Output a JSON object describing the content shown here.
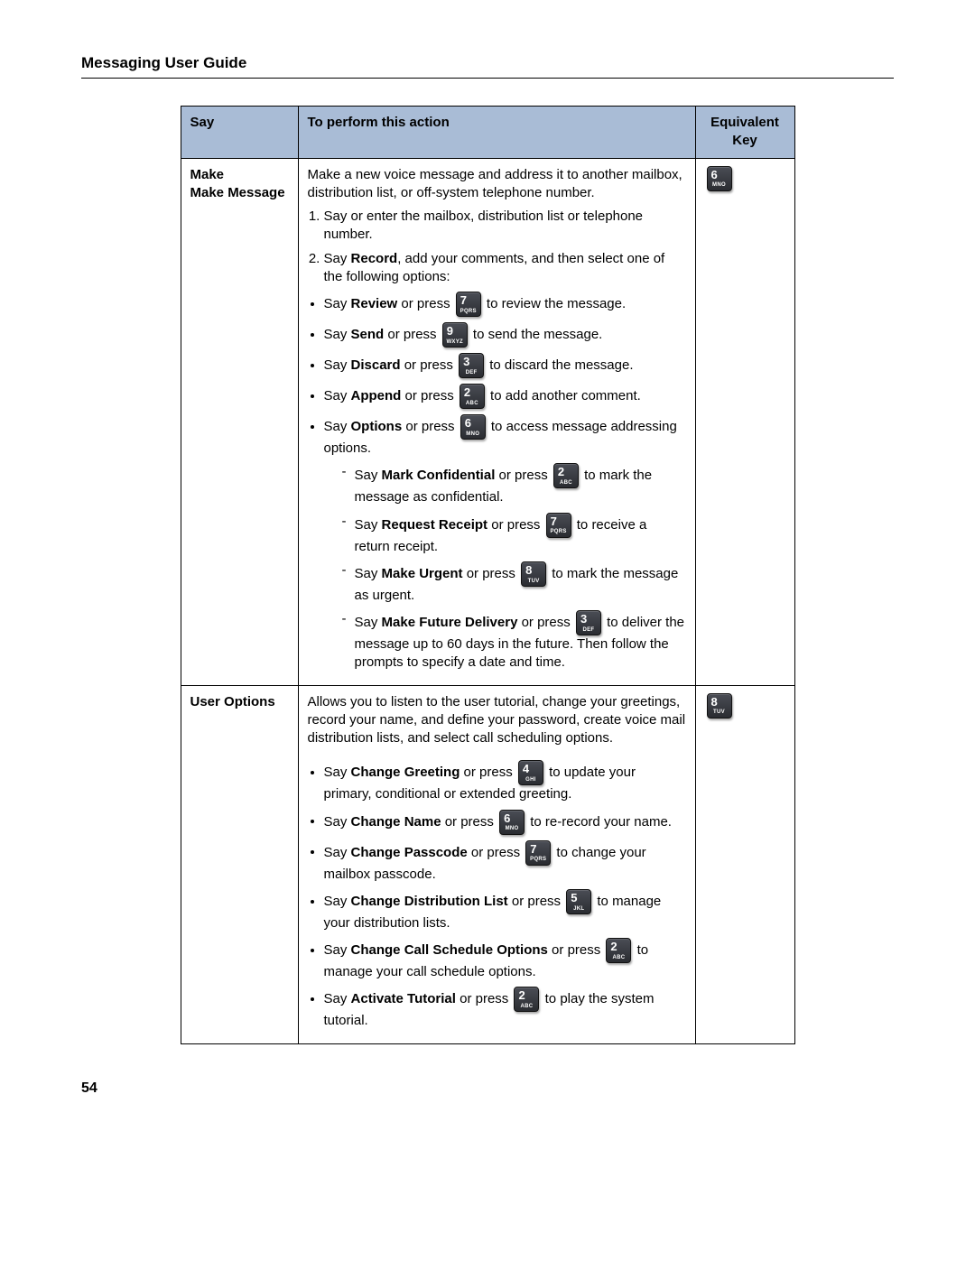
{
  "header": "Messaging User Guide",
  "pageNumber": "54",
  "columns": {
    "say": "Say",
    "action": "To perform this action",
    "key": "Equivalent Key"
  },
  "keyLetters": {
    "2": "ABC",
    "3": "DEF",
    "4": "GHI",
    "5": "JKL",
    "6": "MNO",
    "7": "PQRS",
    "8": "TUV",
    "9": "WXYZ"
  },
  "rows": {
    "make": {
      "say1": "Make",
      "say2": "Make Message",
      "intro": "Make a new voice message and address it to another mailbox, distribution list, or off-system telephone number.",
      "step1": "Say or enter the mailbox, distribution list or telephone number.",
      "step2_pre": "Say ",
      "step2_bold": "Record",
      "step2_post": ", add your comments, and then select one of the following options:",
      "review_pre": "Say ",
      "review_bold": "Review",
      "review_mid": " or press ",
      "review_key": "7",
      "review_post": " to review the message.",
      "send_pre": "Say ",
      "send_bold": "Send",
      "send_mid": " or press ",
      "send_key": "9",
      "send_post": " to send the message.",
      "discard_pre": "Say ",
      "discard_bold": "Discard",
      "discard_mid": " or press ",
      "discard_key": "3",
      "discard_post": " to discard the message.",
      "append_pre": "Say ",
      "append_bold": "Append",
      "append_mid": " or press ",
      "append_key": "2",
      "append_post": " to add another comment.",
      "options_pre": "Say ",
      "options_bold": "Options",
      "options_mid": " or press ",
      "options_key": "6",
      "options_post": " to access message addressing options.",
      "conf_pre": "Say ",
      "conf_bold": "Mark Confidential",
      "conf_mid": " or press ",
      "conf_key": "2",
      "conf_post": " to mark the message as confidential.",
      "rr_pre": "Say ",
      "rr_bold": "Request Receipt",
      "rr_mid": " or press ",
      "rr_key": "7",
      "rr_post": " to receive a return receipt.",
      "urg_pre": "Say ",
      "urg_bold": "Make Urgent",
      "urg_mid": " or press ",
      "urg_key": "8",
      "urg_post": " to mark the message as urgent.",
      "fut_pre": "Say ",
      "fut_bold": "Make Future Delivery",
      "fut_mid": " or press ",
      "fut_key": "3",
      "fut_post": " to deliver the message up to 60 days in the future. Then follow the prompts to specify a date and time.",
      "eqKey": "6"
    },
    "user": {
      "say": "User Options",
      "intro": "Allows you to listen to the user tutorial, change your greetings, record your name, and define your password, create voice mail distribution lists, and select call scheduling options.",
      "cg_pre": "Say ",
      "cg_bold": "Change Greeting",
      "cg_mid": " or press ",
      "cg_key": "4",
      "cg_post": " to update your primary, conditional or extended greeting.",
      "cn_pre": "Say ",
      "cn_bold": "Change Name",
      "cn_mid": " or press ",
      "cn_key": "6",
      "cn_post": " to re-record your name.",
      "cp_pre": "Say ",
      "cp_bold": "Change Passcode",
      "cp_mid": " or press ",
      "cp_key": "7",
      "cp_post": " to change your mailbox passcode.",
      "cd_pre": "Say ",
      "cd_bold": "Change Distribution List",
      "cd_mid": " or press ",
      "cd_key": "5",
      "cd_post": " to manage your distribution lists.",
      "cs_pre": "Say ",
      "cs_bold": "Change Call Schedule Options",
      "cs_mid": " or press ",
      "cs_key": "2",
      "cs_post": " to manage your call schedule options.",
      "at_pre": "Say ",
      "at_bold": "Activate Tutorial",
      "at_mid": " or press ",
      "at_key": "2",
      "at_post": " to play the system tutorial.",
      "eqKey": "8"
    }
  }
}
